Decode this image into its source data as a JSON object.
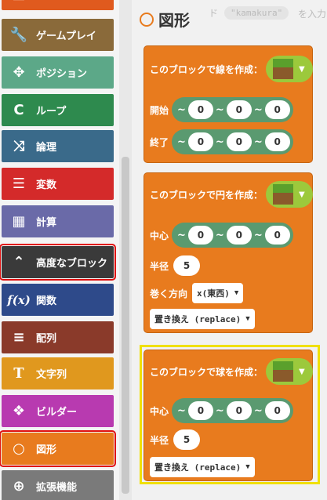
{
  "toolbox": {
    "categories": [
      {
        "label": "",
        "color": "#e05a1e",
        "icon": "category-icon"
      },
      {
        "label": "ゲームプレイ",
        "color": "#8a6a3a",
        "icon": "wrench-icon"
      },
      {
        "label": "ポジション",
        "color": "#5ca888",
        "icon": "move-arrows-icon"
      },
      {
        "label": "ループ",
        "color": "#2e8a4e",
        "icon": "loop-icon"
      },
      {
        "label": "論理",
        "color": "#3a6a8a",
        "icon": "shuffle-icon"
      },
      {
        "label": "変数",
        "color": "#d42a2a",
        "icon": "list-icon"
      },
      {
        "label": "計算",
        "color": "#6a6aa8",
        "icon": "calculator-icon"
      },
      {
        "label": "高度なブロック",
        "color": "#3a3a3a",
        "icon": "chevron-up-icon"
      },
      {
        "label": "関数",
        "color": "#2e4a8a",
        "icon": "function-icon"
      },
      {
        "label": "配列",
        "color": "#8a3a2a",
        "icon": "numbered-list-icon"
      },
      {
        "label": "文字列",
        "color": "#e0981e",
        "icon": "text-icon"
      },
      {
        "label": "ビルダー",
        "color": "#b83ab0",
        "icon": "blocks-icon"
      },
      {
        "label": "図形",
        "color": "#e87b1e",
        "icon": "circle-icon"
      },
      {
        "label": "拡張機能",
        "color": "#7a7a7a",
        "icon": "plus-circle-icon"
      }
    ]
  },
  "flyout": {
    "title": "図形",
    "hint_prefix": "ド",
    "hint_keyword": "\"kamakura\"",
    "hint_suffix": "を入力"
  },
  "blocks": {
    "line": {
      "label": "このブロックで線を作成：",
      "start_label": "開始",
      "end_label": "終了",
      "start": [
        "0",
        "0",
        "0"
      ],
      "end": [
        "0",
        "0",
        "0"
      ]
    },
    "circle": {
      "label": "このブロックで円を作成：",
      "center_label": "中心",
      "center": [
        "0",
        "0",
        "0"
      ],
      "radius_label": "半径",
      "radius": "5",
      "direction_label": "巻く方向",
      "direction": "x(東西)",
      "mode": "置き換え (replace)"
    },
    "sphere": {
      "label": "このブロックで球を作成：",
      "center_label": "中心",
      "center": [
        "0",
        "0",
        "0"
      ],
      "radius_label": "半径",
      "radius": "5",
      "mode": "置き換え (replace)"
    }
  },
  "coord_sep": "~"
}
